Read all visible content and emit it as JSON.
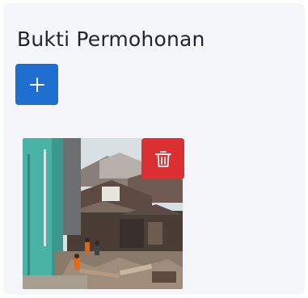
{
  "section": {
    "title": "Bukti Permohonan"
  },
  "icons": {
    "add": "plus-icon",
    "delete": "trash-icon"
  },
  "colors": {
    "add_button": "#1f6fd1",
    "delete_button": "#dc2f32",
    "panel_background": "#f5f6fa",
    "title_text": "#1f2430"
  }
}
